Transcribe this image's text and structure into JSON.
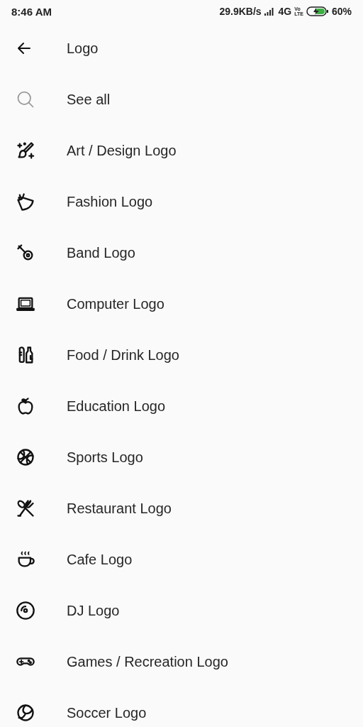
{
  "status_bar": {
    "time": "8:46 AM",
    "speed": "29.9KB/s",
    "network": "4G",
    "volte": [
      "Vo",
      "LTE"
    ],
    "battery": "60%"
  },
  "header": {
    "title": "Logo"
  },
  "items": [
    {
      "kind": "search",
      "label": "See all"
    },
    {
      "kind": "art",
      "label": "Art / Design Logo"
    },
    {
      "kind": "fashion",
      "label": "Fashion Logo"
    },
    {
      "kind": "band",
      "label": "Band Logo"
    },
    {
      "kind": "computer",
      "label": "Computer Logo"
    },
    {
      "kind": "food",
      "label": "Food / Drink Logo"
    },
    {
      "kind": "education",
      "label": "Education Logo"
    },
    {
      "kind": "sports",
      "label": "Sports Logo"
    },
    {
      "kind": "restaurant",
      "label": "Restaurant Logo"
    },
    {
      "kind": "cafe",
      "label": "Cafe Logo"
    },
    {
      "kind": "dj",
      "label": "DJ Logo"
    },
    {
      "kind": "games",
      "label": "Games / Recreation Logo"
    },
    {
      "kind": "soccer",
      "label": "Soccer Logo"
    }
  ]
}
